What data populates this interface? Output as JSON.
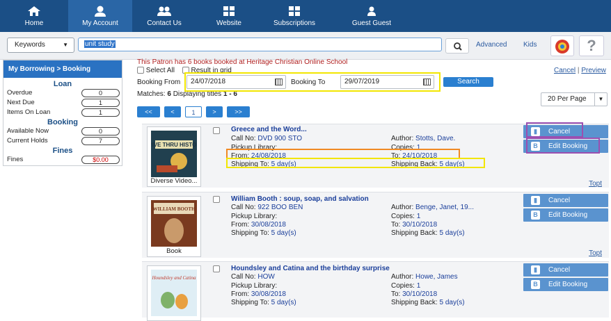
{
  "nav": {
    "items": [
      {
        "label": "Home",
        "icon": "home-icon"
      },
      {
        "label": "My Account",
        "icon": "user-icon"
      },
      {
        "label": "Contact Us",
        "icon": "people-icon"
      },
      {
        "label": "Website",
        "icon": "grid-icon"
      },
      {
        "label": "Subscriptions",
        "icon": "grid-icon"
      },
      {
        "label": "Guest Guest",
        "icon": "person-icon"
      }
    ]
  },
  "search": {
    "scope": "Keywords",
    "query": "unit study",
    "advanced": "Advanced",
    "kids": "Kids"
  },
  "sidebar": {
    "heading": "My Borrowing > Booking",
    "loan_title": "Loan",
    "loan": [
      {
        "label": "Overdue",
        "value": "0"
      },
      {
        "label": "Next Due",
        "value": "1"
      },
      {
        "label": "Items On Loan",
        "value": "1"
      }
    ],
    "booking_title": "Booking",
    "booking": [
      {
        "label": "Available Now",
        "value": "0"
      },
      {
        "label": "Current Holds",
        "value": "7"
      }
    ],
    "fines_title": "Fines",
    "fines": [
      {
        "label": "Fines",
        "value": "$0.00"
      }
    ]
  },
  "main": {
    "notice": "This Patron has 6 books booked at Heritage Christian Online School",
    "cancel_link": "Cancel",
    "preview_link": "Preview",
    "select_all": "Select All",
    "result_grid": "Result in grid",
    "booking_from_label": "Booking From",
    "booking_from": "24/07/2018",
    "booking_to_label": "Booking To",
    "booking_to": "29/07/2019",
    "search_button": "Search",
    "matches_label": "Matches:",
    "matches_count": "6",
    "displaying_label": "Displaying titles",
    "displaying_range": "1 - 6",
    "per_page": "20 Per Page",
    "pager": [
      "<<",
      "<",
      "1",
      ">",
      ">>"
    ]
  },
  "results": [
    {
      "title": "Greece and the Word...",
      "call_no": "DVD 900 STO",
      "author": "Stotts, Dave.",
      "pickup": "",
      "copies": "1",
      "from": "24/08/2018",
      "to": "24/10/2018",
      "shipping_to": "5 day(s)",
      "shipping_back": "5 day(s)",
      "cover_caption": "Diverse Video...",
      "cover_text": "DRIVE THRU HISTORY"
    },
    {
      "title": "William Booth : soup, soap, and salvation",
      "call_no": "922 BOO BEN",
      "author": "Benge, Janet, 19...",
      "pickup": "",
      "copies": "1",
      "from": "30/08/2018",
      "to": "30/10/2018",
      "shipping_to": "5 day(s)",
      "shipping_back": "5 day(s)",
      "cover_caption": "Book",
      "cover_text": "WILLIAM BOOTH"
    },
    {
      "title": "Houndsley and Catina and the birthday surprise",
      "call_no": "HOW",
      "author": "Howe, James",
      "pickup": "",
      "copies": "1",
      "from": "30/08/2018",
      "to": "30/10/2018",
      "shipping_to": "5 day(s)",
      "shipping_back": "5 day(s)",
      "cover_caption": "",
      "cover_text": "Houndsley and Catina"
    }
  ],
  "labels": {
    "call_no": "Call No:",
    "author": "Author:",
    "pickup": "Pickup Library:",
    "copies": "Copies:",
    "from": "From:",
    "to": "To:",
    "shipping_to": "Shipping To:",
    "shipping_back": "Shipping Back:",
    "cancel": "Cancel",
    "edit_booking": "Edit Booking",
    "top": "Topt"
  },
  "colors": {
    "nav_bg": "#1b4f86",
    "accent": "#2a7fd0",
    "highlight_yellow": "#f2e600",
    "highlight_orange": "#f08a24",
    "highlight_purple": "#9b4fb0"
  }
}
